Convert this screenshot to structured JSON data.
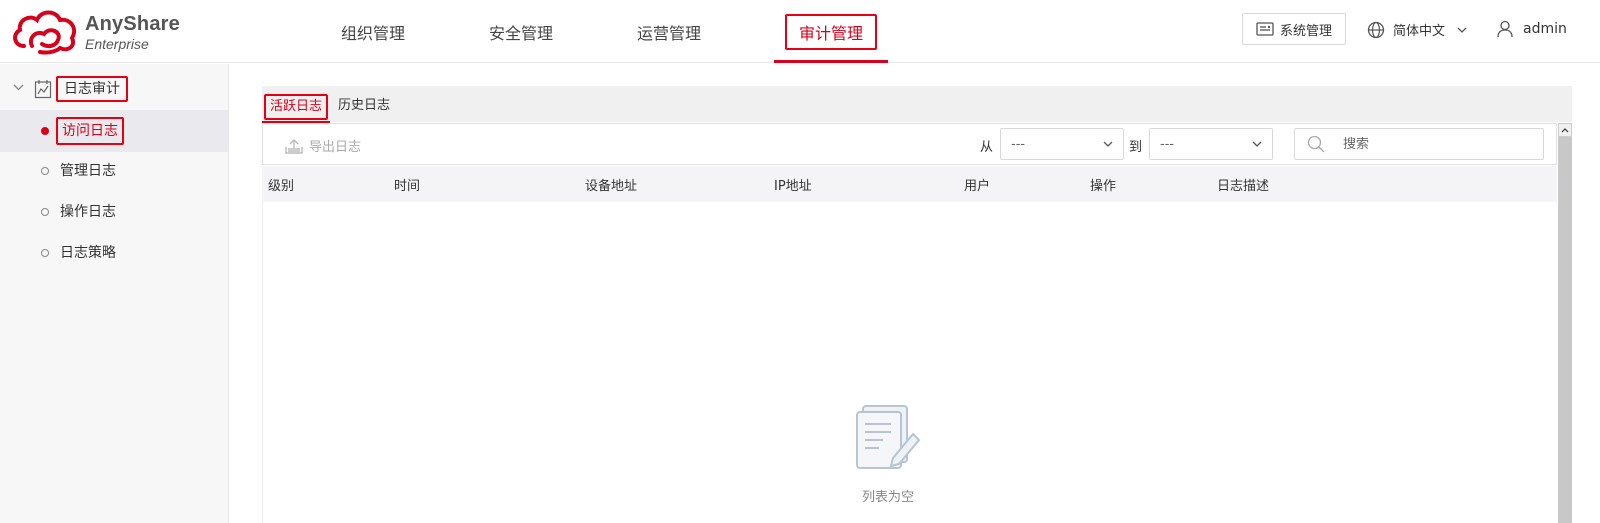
{
  "app": {
    "brand": "AnyShare",
    "edition": "Enterprise"
  },
  "colors": {
    "accent": "#d9001b",
    "highlight_border": "#e60012"
  },
  "nav": {
    "items": [
      {
        "label": "组织管理",
        "active": false
      },
      {
        "label": "安全管理",
        "active": false
      },
      {
        "label": "运营管理",
        "active": false
      },
      {
        "label": "审计管理",
        "active": true
      }
    ]
  },
  "header_right": {
    "system_button": "系统管理",
    "language": "简体中文",
    "user": "admin"
  },
  "sidebar": {
    "group_label": "日志审计",
    "items": [
      {
        "label": "访问日志",
        "active": true
      },
      {
        "label": "管理日志",
        "active": false
      },
      {
        "label": "操作日志",
        "active": false
      },
      {
        "label": "日志策略",
        "active": false
      }
    ]
  },
  "tabs": [
    {
      "label": "活跃日志",
      "active": true
    },
    {
      "label": "历史日志",
      "active": false
    }
  ],
  "toolbar": {
    "export_label": "导出日志",
    "from_label": "从",
    "to_label": "到",
    "from_value": "---",
    "to_value": "---",
    "search_placeholder": "搜索"
  },
  "table": {
    "columns": [
      "级别",
      "时间",
      "设备地址",
      "IP地址",
      "用户",
      "操作",
      "日志描述"
    ],
    "empty_text": "列表为空"
  },
  "icons": {
    "logo": "anyshare-logo-icon",
    "system": "server-icon",
    "language": "globe-icon",
    "user": "user-icon",
    "group": "calendar-chart-icon",
    "export": "upload-icon",
    "search": "search-icon",
    "empty": "empty-document-icon"
  }
}
